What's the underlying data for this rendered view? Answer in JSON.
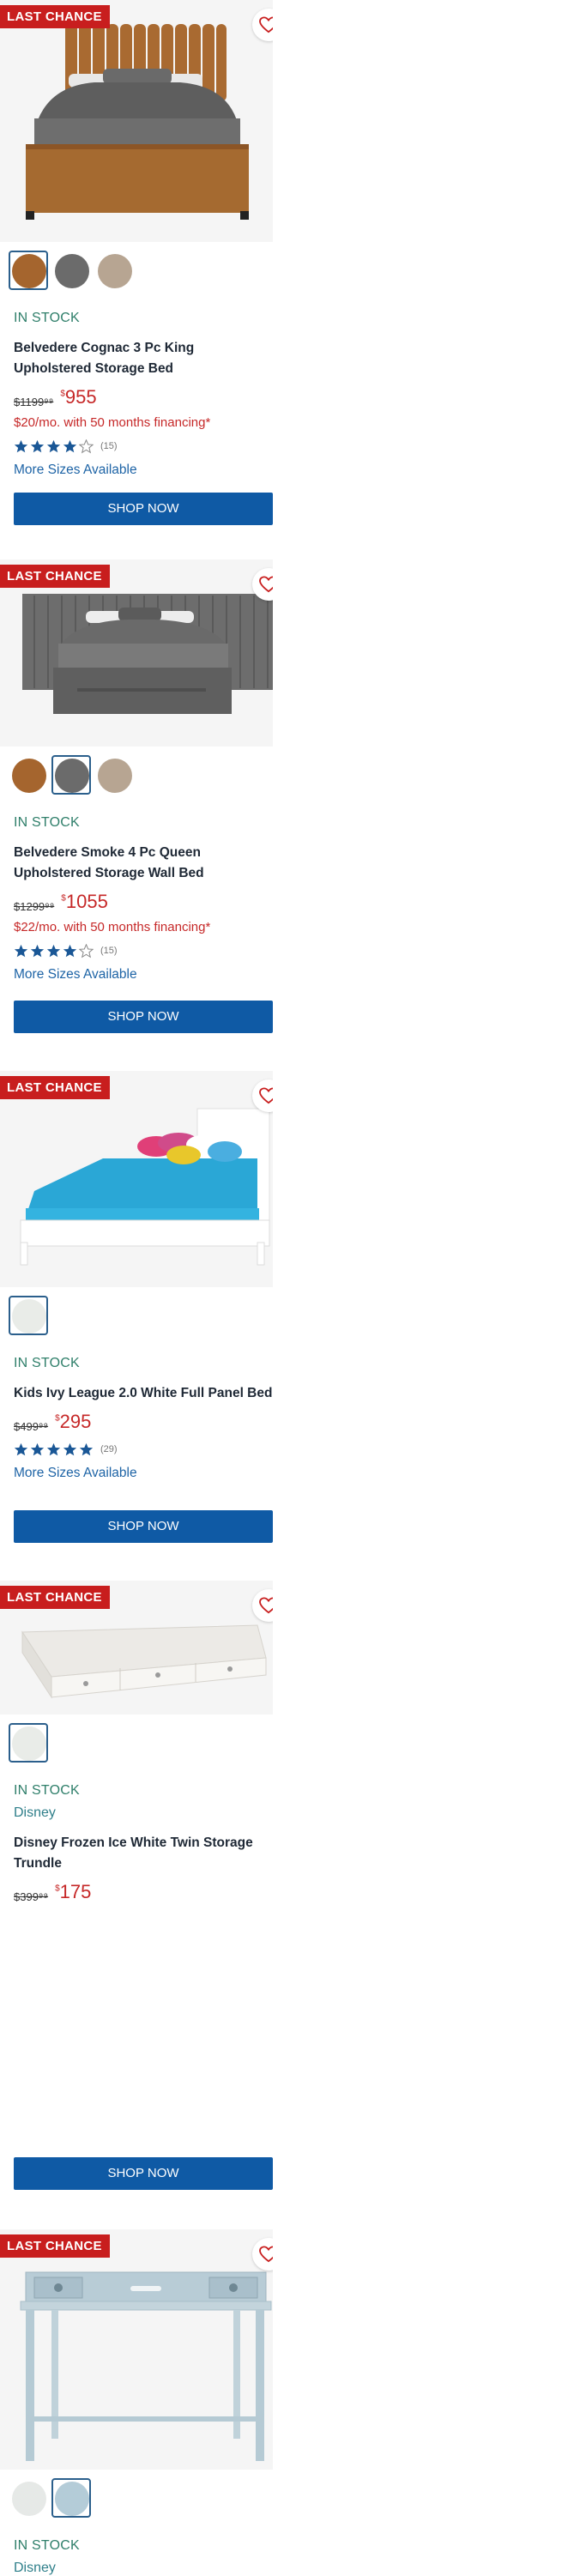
{
  "products": [
    {
      "badge": "LAST CHANCE",
      "image_alt": "Belvedere Cognac bed",
      "swatch_colors": [
        "#a5652e",
        "#6b6b6b",
        "#b7a592"
      ],
      "stock": "IN STOCK",
      "title": "Belvedere Cognac 3 Pc King Upholstered Storage Bed",
      "was_price": "$1199⁹⁹",
      "now_price_currency": "$",
      "now_price": "955",
      "financing": "$20/mo. with 50 months financing*",
      "rating": 4,
      "review_count": "(15)",
      "more_sizes": "More Sizes Available",
      "cta": "SHOP NOW"
    },
    {
      "badge": "LAST CHANCE",
      "swatch_colors": [
        "#a5652e",
        "#6b6b6b",
        "#b7a592"
      ],
      "stock": "IN STOCK",
      "title": "Belvedere Smoke 4 Pc Queen Upholstered Storage Wall Bed",
      "was_price": "$1299⁹⁹",
      "now_price_currency": "$",
      "now_price": "1055",
      "financing": "$22/mo. with 50 months financing*",
      "rating": 4,
      "review_count": "(15)",
      "more_sizes": "More Sizes Available",
      "cta": "SHOP NOW"
    },
    {
      "badge": "LAST CHANCE",
      "swatch_colors": [
        "#e9ece8"
      ],
      "stock": "IN STOCK",
      "title": "Kids Ivy League 2.0 White Full Panel Bed",
      "was_price": "$499⁹⁹",
      "now_price_currency": "$",
      "now_price": "295",
      "rating": 4.5,
      "review_count": "(29)",
      "more_sizes": "More Sizes Available",
      "cta": "SHOP NOW"
    },
    {
      "badge": "LAST CHANCE",
      "swatch_colors": [
        "#e9ece8"
      ],
      "stock": "IN STOCK",
      "brand": "Disney",
      "title": "Disney Frozen Ice White Twin Storage Trundle",
      "was_price": "$399⁹⁹",
      "now_price_currency": "$",
      "now_price": "175",
      "cta": "SHOP NOW"
    },
    {
      "badge": "LAST CHANCE",
      "swatch_colors": [
        "#e6e9e7",
        "#b4ccd8"
      ],
      "stock": "IN STOCK",
      "brand": "Disney"
    }
  ]
}
